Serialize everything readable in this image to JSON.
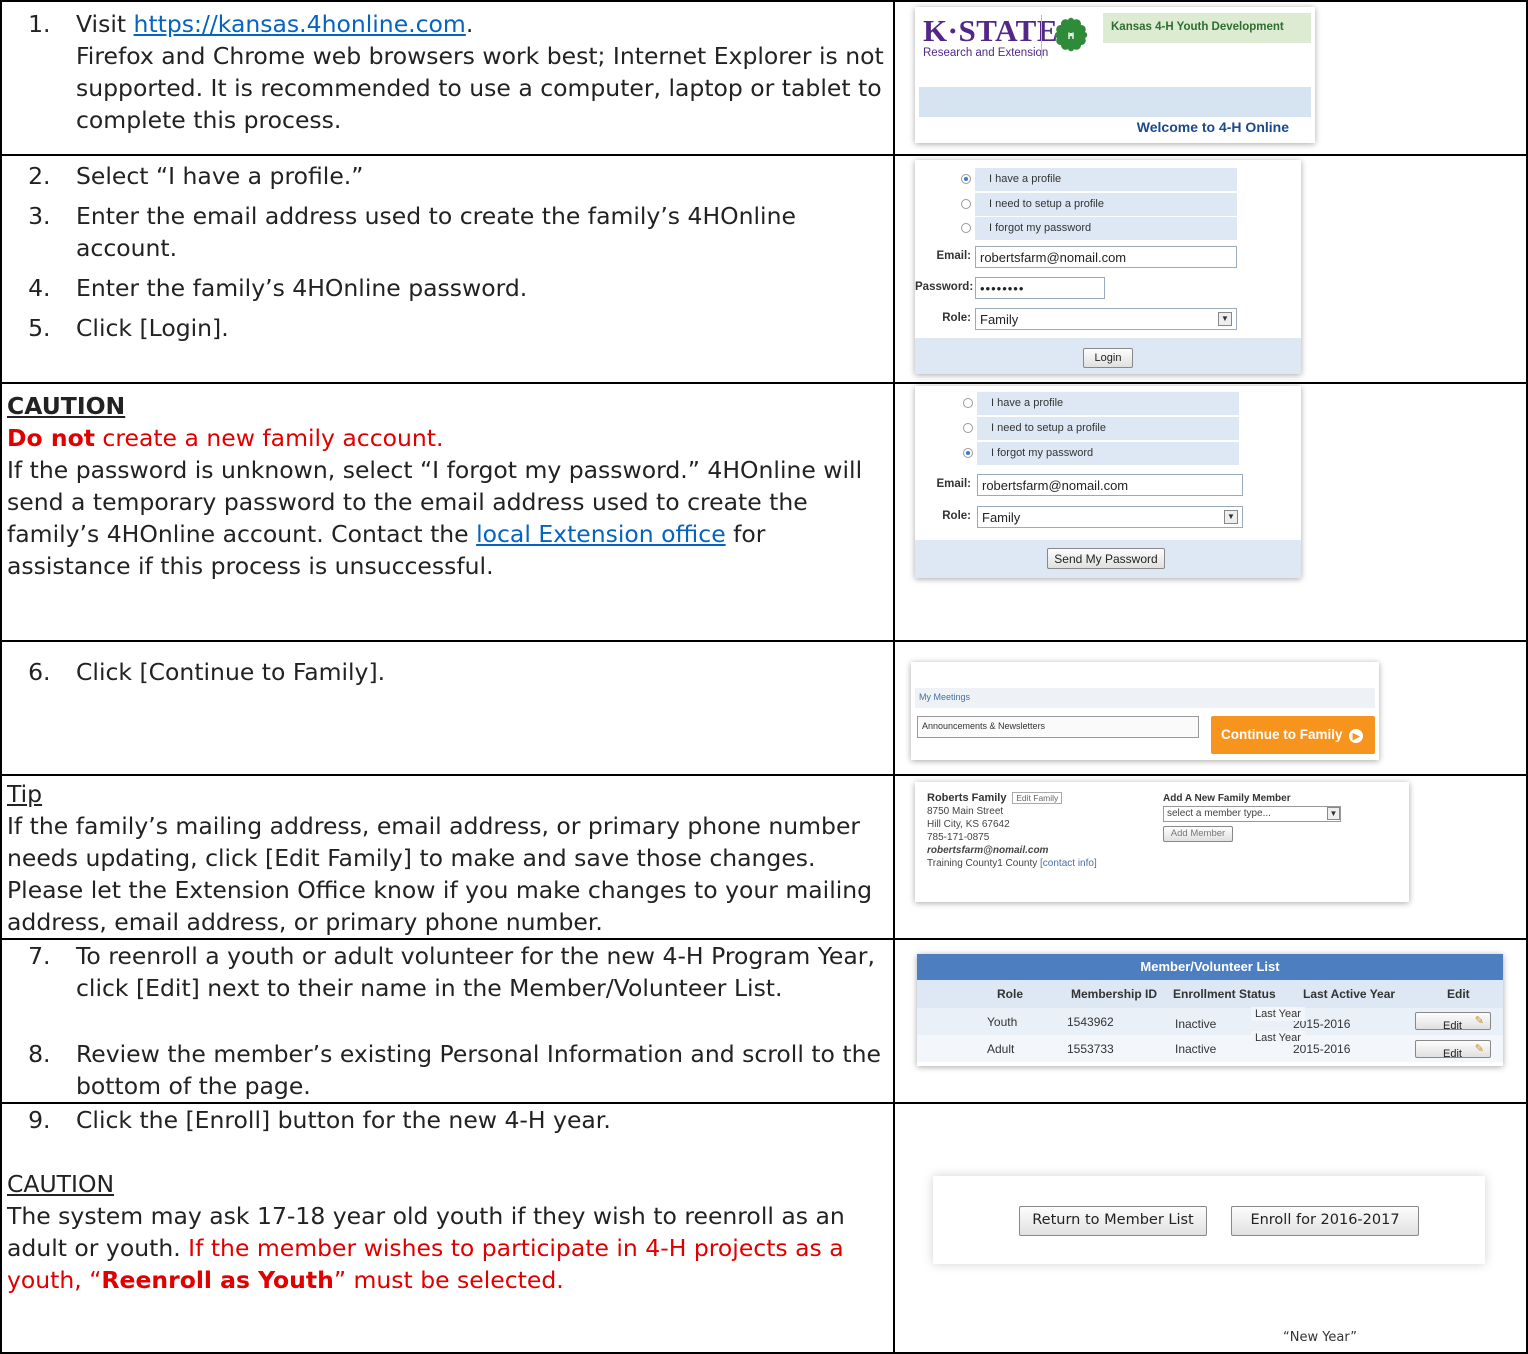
{
  "steps": {
    "s1": {
      "num": "1.",
      "prefix": "Visit ",
      "link": "https://kansas.4honline.com",
      "suffix": ".",
      "note": "Firefox and Chrome web browsers work best; Internet Explorer is not supported.  It is recommended to use a computer, laptop or tablet to complete this process."
    },
    "s2": {
      "num": "2.",
      "text": "Select “I have a profile.”"
    },
    "s3": {
      "num": "3.",
      "text": "Enter the email address used to create the family’s 4HOnline account."
    },
    "s4": {
      "num": "4.",
      "text": "Enter the family’s 4HOnline password."
    },
    "s5": {
      "num": "5.",
      "text": "Click [Login]."
    },
    "s6": {
      "num": "6.",
      "text": "Click [Continue to Family]."
    },
    "s7": {
      "num": "7.",
      "text": "To reenroll a youth or adult volunteer for the new 4-H Program Year, click [Edit] next to their name in the Member/Volunteer List."
    },
    "s8": {
      "num": "8.",
      "text": "Review the member’s existing Personal Information and scroll to the bottom of the page."
    },
    "s9": {
      "num": "9.",
      "text": "Click the [Enroll] button for the new 4-H year."
    }
  },
  "caution1": {
    "heading": "CAUTION",
    "red_bold": "Do not",
    "red_rest": " create a new family account.",
    "body_pre": "If the password is unknown, select “I forgot my password.”  4HOnline will send a temporary password to the email address used to create the family’s 4HOnline account.  Contact the ",
    "link": "local Extension office",
    "body_post": " for assistance if this process is unsuccessful."
  },
  "tip": {
    "heading": "Tip",
    "body": "If the family’s mailing address, email address, or primary phone number needs updating, click [Edit Family] to make and save those changes.  Please let the Extension Office know if you make changes to your mailing address, email address, or primary phone number."
  },
  "caution2": {
    "heading": "CAUTION",
    "body": "The system may ask 17-18 year old youth if they wish to reenroll as an adult or youth.  ",
    "red1": "If the member wishes to participate in 4-H projects as a youth, “",
    "red_bold": "Reenroll as Youth",
    "red2": "” must be selected."
  },
  "shot_header": {
    "brand": "K·STATE",
    "brand_sub": "Research and Extension",
    "title": "Kansas 4-H Youth Development",
    "welcome": "Welcome to 4-H Online"
  },
  "shot_login": {
    "options": [
      "I have a profile",
      "I need to setup a profile",
      "I forgot my password"
    ],
    "email_label": "Email:",
    "email_value": "robertsfarm@nomail.com",
    "password_label": "Password:",
    "password_value": "••••••••",
    "role_label": "Role:",
    "role_value": "Family",
    "login_button": "Login"
  },
  "shot_forgot": {
    "options": [
      "I have a profile",
      "I need to setup a profile",
      "I forgot my password"
    ],
    "email_label": "Email:",
    "email_value": "robertsfarm@nomail.com",
    "role_label": "Role:",
    "role_value": "Family",
    "send_button": "Send My Password"
  },
  "shot_continue": {
    "my_meetings": "My Meetings",
    "announcements": "Announcements & Newsletters",
    "continue_button": "Continue to Family"
  },
  "shot_family": {
    "name": "Roberts Family",
    "edit_family": "Edit Family",
    "street": "8750 Main Street",
    "city": "Hill City, KS 67642",
    "phone": "785-171-0875",
    "email": "robertsfarm@nomail.com",
    "county": "Training County1 County",
    "contact_info": "[contact info]",
    "add_heading": "Add A New Family Member",
    "select_placeholder": "select a member type...",
    "add_button": "Add Member"
  },
  "shot_members": {
    "title": "Member/Volunteer List",
    "columns": [
      "Role",
      "Membership ID",
      "Enrollment Status",
      "Last Active Year",
      "Edit"
    ],
    "rows": [
      {
        "role": "Youth",
        "id": "1543962",
        "status": "Inactive",
        "year": "2015-2016",
        "edit": "Edit"
      },
      {
        "role": "Adult",
        "id": "1553733",
        "status": "Inactive",
        "year": "2015-2016",
        "edit": "Edit"
      }
    ],
    "tooltip": "Last Year"
  },
  "shot_enroll": {
    "return_button": "Return to Member List",
    "enroll_button": "Enroll for 2016-2017",
    "caption": "“New Year”"
  },
  "colors": {
    "kstate_purple": "#512888",
    "accent_orange": "#f7941d",
    "list_header_blue": "#4d7ebf",
    "caution_red": "#e00000"
  }
}
